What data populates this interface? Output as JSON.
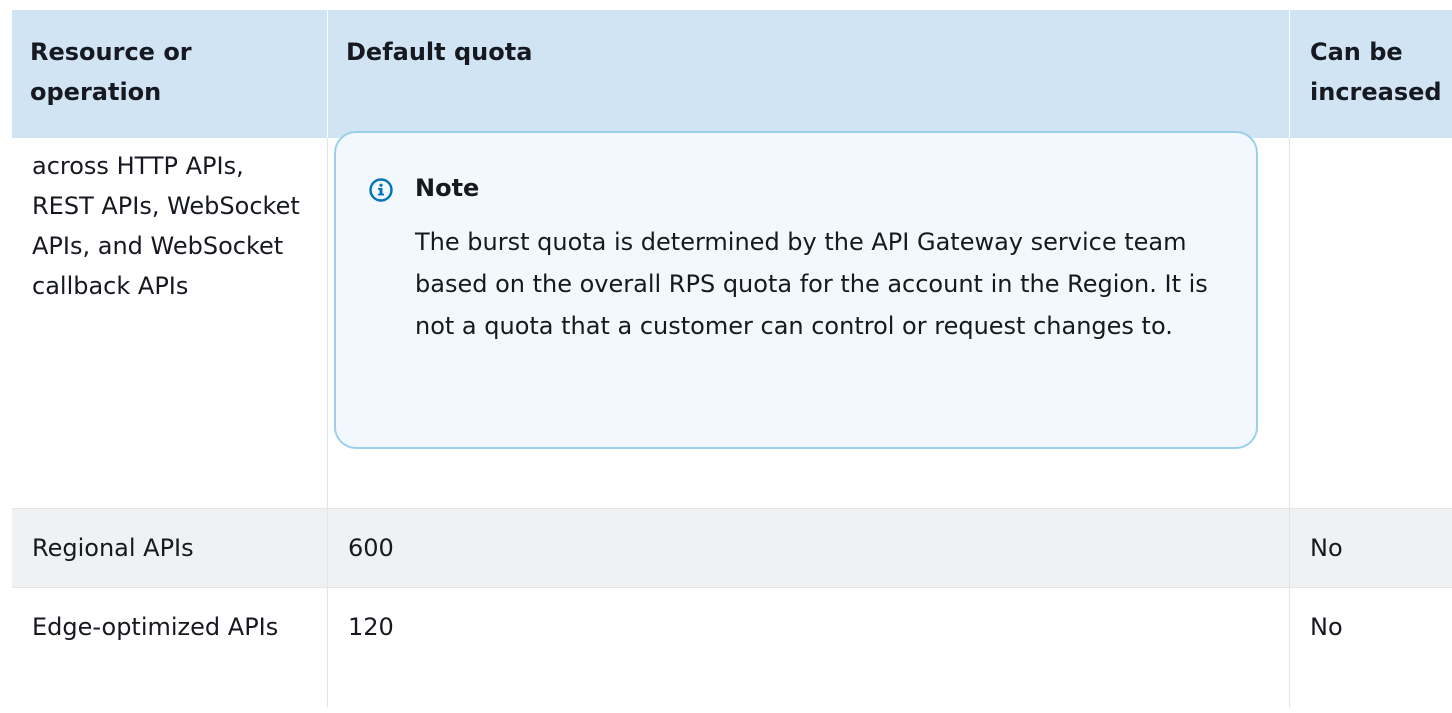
{
  "table": {
    "headers": {
      "resource": "Resource or operation",
      "default_quota": "Default quota",
      "can_be_increased": "Can be increased"
    },
    "rows": [
      {
        "resource": "across HTTP APIs, REST APIs, WebSocket APIs, and WebSocket callback APIs",
        "note": {
          "title": "Note",
          "body": "The burst quota is determined by the API Gateway service team based on the overall RPS quota for the account in the Region. It is not a quota that a customer can control or request changes to."
        }
      },
      {
        "resource": "Regional APIs",
        "default_quota": "600",
        "can_be_increased": "No"
      },
      {
        "resource": "Edge-optimized APIs",
        "default_quota": "120",
        "can_be_increased": "No"
      }
    ]
  },
  "colors": {
    "header_bg": "#d1e4f4",
    "note_border": "#9ad0ea",
    "note_bg": "#f2f8fd",
    "info_icon": "#0073bb",
    "striped_row_bg": "#f0f1f2"
  },
  "icons": {
    "note_icon": "info-icon"
  }
}
